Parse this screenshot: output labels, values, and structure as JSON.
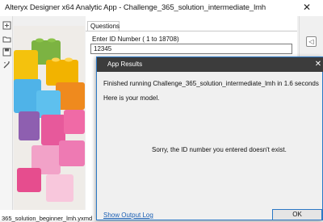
{
  "window": {
    "title": "Alteryx Designer x64  Analytic App  - Challenge_365_solution_intermediate_lmh",
    "close_glyph": "✕"
  },
  "questions": {
    "tab_label": "Questions",
    "id_label": "Enter ID Number ( 1 to 18708)",
    "id_value": "12345"
  },
  "rail": {
    "button_glyph": "◁"
  },
  "bottom": {
    "text": "365_solution_beginner_lmh.yxmd"
  },
  "dialog": {
    "title": "App Results",
    "close_glyph": "✕",
    "finished": "Finished running Challenge_365_solution_intermediate_lmh in 1.6 seconds",
    "model": "Here is your model.",
    "sorry": "Sorry, the ID number you entered doesn't exist.",
    "show_output_log": "Show Output Log",
    "ok": "OK"
  }
}
